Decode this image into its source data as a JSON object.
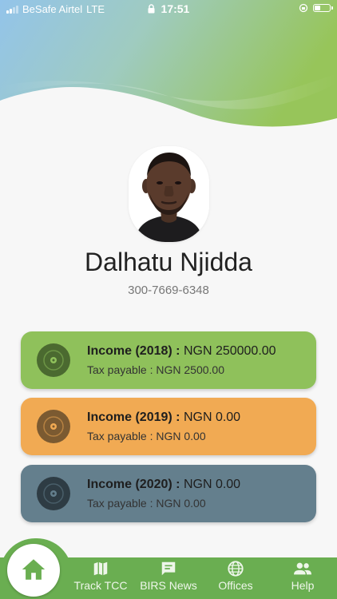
{
  "status_bar": {
    "carrier": "BeSafe Airtel",
    "network": "LTE",
    "time": "17:51",
    "battery_level": 0.3
  },
  "profile": {
    "name": "Dalhatu Njidda",
    "phone": "300-7669-6348"
  },
  "incomes": [
    {
      "title": "Income (2018) :",
      "amount": "NGN 250000.00",
      "tax": "Tax payable : NGN 2500.00",
      "color": "#8fc15b",
      "icon": "disc-icon"
    },
    {
      "title": "Income (2019) :",
      "amount": "NGN 0.00",
      "tax": "Tax payable : NGN 0.00",
      "color": "#f1aa53",
      "icon": "disc-icon"
    },
    {
      "title": "Income (2020) :",
      "amount": "NGN 0.00",
      "tax": "Tax payable : NGN 0.00",
      "color": "#647f8d",
      "icon": "disc-icon"
    }
  ],
  "nav": {
    "home_icon": "home-icon",
    "items": [
      {
        "label": "Track TCC",
        "icon": "map-icon"
      },
      {
        "label": "BIRS News",
        "icon": "chat-icon"
      },
      {
        "label": "Offices",
        "icon": "globe-icon"
      },
      {
        "label": "Help",
        "icon": "people-icon"
      }
    ]
  },
  "colors": {
    "nav_green": "#6aae51",
    "header_blue": "#8ec3e8",
    "header_green": "#9cc95e"
  }
}
